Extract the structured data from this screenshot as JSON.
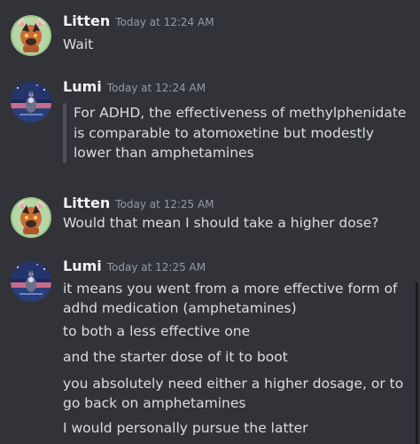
{
  "messages": [
    {
      "username": "Litten",
      "timestamp": "Today at 12:24 AM",
      "lines": [
        "Wait"
      ]
    },
    {
      "username": "Lumi",
      "timestamp": "Today at 12:24 AM",
      "quote": "For ADHD, the effectiveness of methylphenidate is comparable to atomoxetine but modestly lower than amphetamines"
    },
    {
      "username": "Litten",
      "timestamp": "Today at 12:25 AM",
      "lines": [
        "Would that mean I should take a higher dose?"
      ]
    },
    {
      "username": "Lumi",
      "timestamp": "Today at 12:25 AM",
      "lines": [
        "it means you went from a more effective form of adhd medication (amphetamines)",
        "to both a less effective one",
        "and the starter dose of it to boot",
        "you absolutely need either a higher dosage, or to go back on amphetamines",
        "I would personally pursue the latter"
      ]
    }
  ],
  "colors": {
    "background": "#313338",
    "username": "#f2f3f5",
    "timestamp": "#949ba4",
    "text": "#dbdee1",
    "quote_bar": "#4e5058"
  },
  "icons": {
    "litten_avatar": "cat-avatar-icon",
    "lumi_avatar": "night-sky-avatar-icon"
  }
}
